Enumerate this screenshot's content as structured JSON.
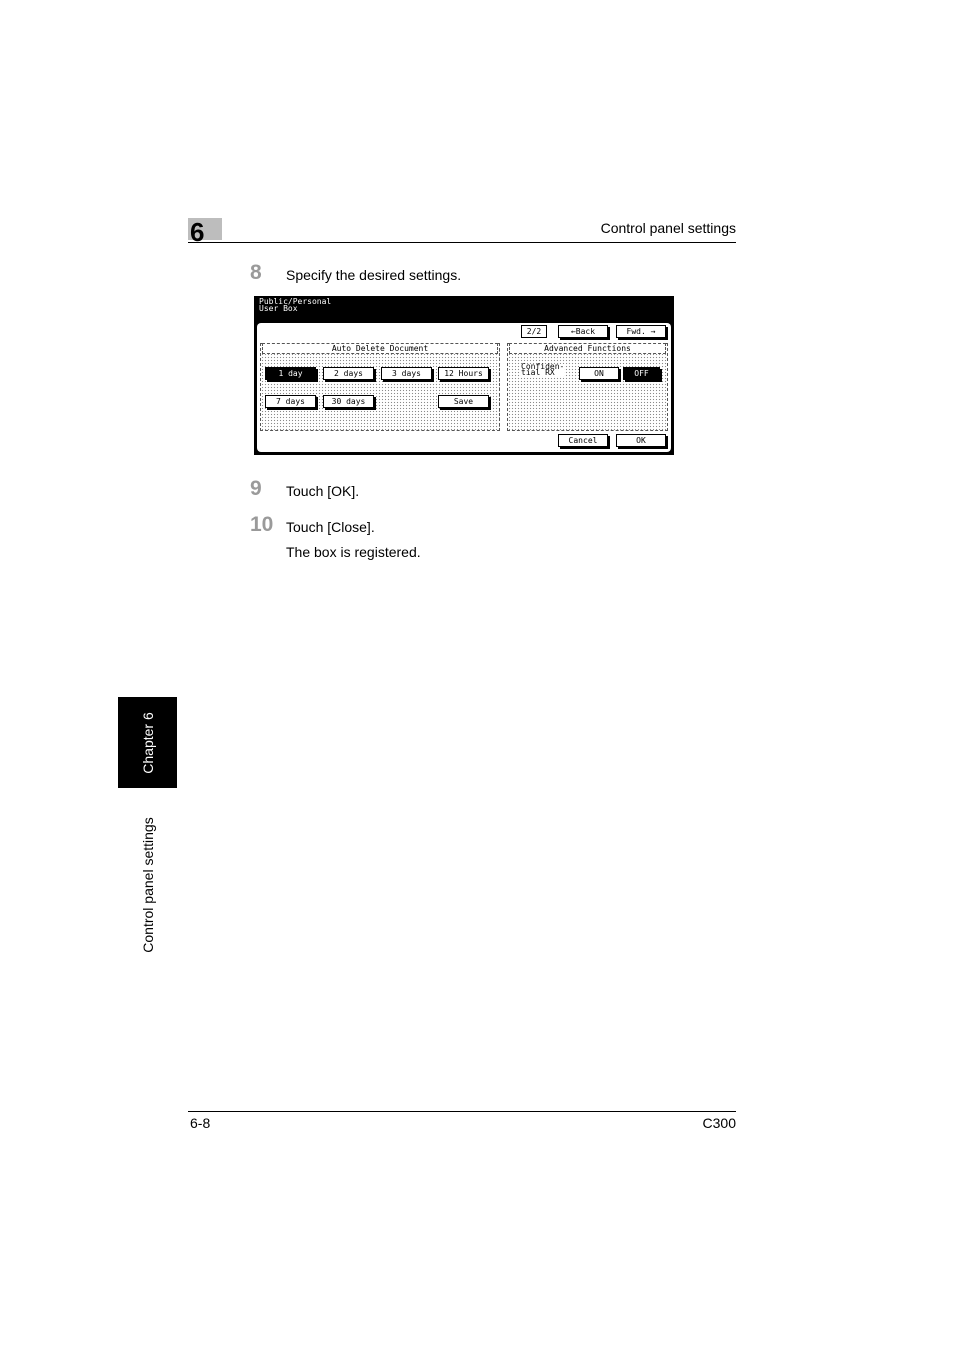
{
  "header": {
    "chapter_number": "6",
    "title": "Control panel settings"
  },
  "steps": [
    {
      "number": "8",
      "text": "Specify the desired settings."
    },
    {
      "number": "9",
      "text": "Touch [OK]."
    },
    {
      "number": "10",
      "text": "Touch [Close].",
      "result": "The box is registered."
    }
  ],
  "screen": {
    "title_line1": "Public/Personal",
    "title_line2": "User Box",
    "page_indicator": "2/2",
    "back_label": "←Back",
    "fwd_label": "Fwd. →",
    "auto_delete": {
      "label": "Auto Delete Document",
      "options": [
        "1 day",
        "2 days",
        "3 days",
        "12 Hours",
        "7 days",
        "30 days"
      ],
      "selected": "1 day",
      "save_label": "Save"
    },
    "advanced": {
      "label": "Advanced Functions",
      "setting_line1": "Confiden-",
      "setting_line2": "tial RX",
      "on_label": "ON",
      "off_label": "OFF",
      "selected": "OFF"
    },
    "cancel_label": "Cancel",
    "ok_label": "OK"
  },
  "side_tab": {
    "chapter_label": "Chapter 6",
    "section_label": "Control panel settings"
  },
  "footer": {
    "page": "6-8",
    "model": "C300"
  }
}
